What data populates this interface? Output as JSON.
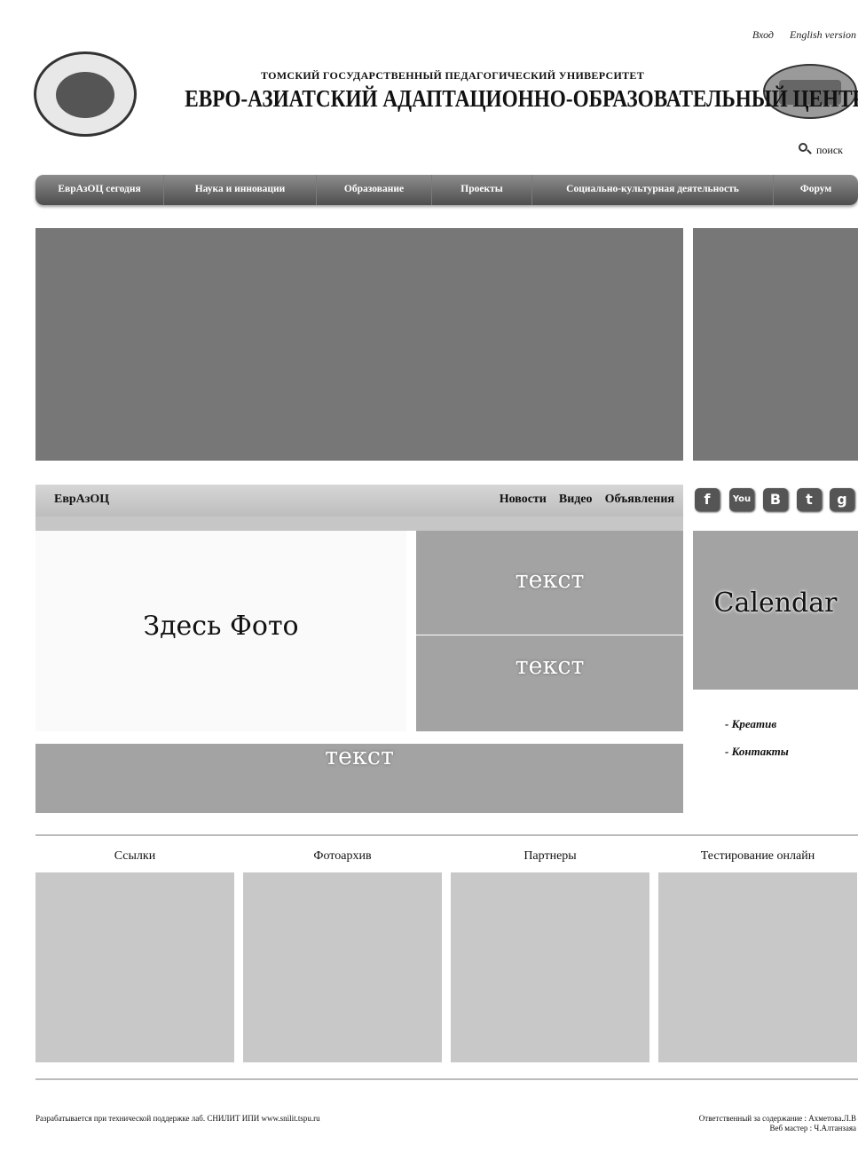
{
  "top_links": {
    "login": "Вход",
    "english": "English version"
  },
  "header": {
    "university": "ТОМСКИЙ ГОСУДАРСТВЕННЫЙ ПЕДАГОГИЧЕСКИЙ УНИВЕРСИТЕТ",
    "center": "ЕВРО-АЗИАТСКИЙ АДАПТАЦИОННО-ОБРАЗОВАТЕЛЬНЫЙ ЦЕНТР"
  },
  "search": {
    "label": "поиск"
  },
  "nav": [
    {
      "label": "ЕврАзОЦ сегодня"
    },
    {
      "label": "Наука и инновации"
    },
    {
      "label": "Образование"
    },
    {
      "label": "Проекты"
    },
    {
      "label": "Социально-культурная деятельность"
    },
    {
      "label": "Форум"
    }
  ],
  "news_bar": {
    "brand": "ЕврАзОЦ",
    "links": [
      "Новости",
      "Видео",
      "Объявления"
    ]
  },
  "social": [
    {
      "icon": "facebook-icon",
      "glyph": "f"
    },
    {
      "icon": "youtube-icon",
      "glyph": "You"
    },
    {
      "icon": "vkontakte-icon",
      "glyph": "B"
    },
    {
      "icon": "twitter-icon",
      "glyph": "t"
    },
    {
      "icon": "google-plus-icon",
      "glyph": "g"
    }
  ],
  "content": {
    "photo": "Здесь Фото",
    "text1": "текст",
    "text2": "текст",
    "text3": "текст",
    "calendar": "Calendar"
  },
  "side_links": [
    "-  Креатив",
    "-  Контакты"
  ],
  "sections": [
    "Ссылки",
    "Фотоархив",
    "Партнеры",
    "Тестирование онлайн"
  ],
  "footer": {
    "left": "Разрабатывается при технической поддержке лаб. СНИЛИТ ИПИ www.snilit.tspu.ru",
    "right1": "Ответственный за содержание : Ахметова.Л.В",
    "right2": "Веб мастер : Ч.Алтанзаяа"
  }
}
